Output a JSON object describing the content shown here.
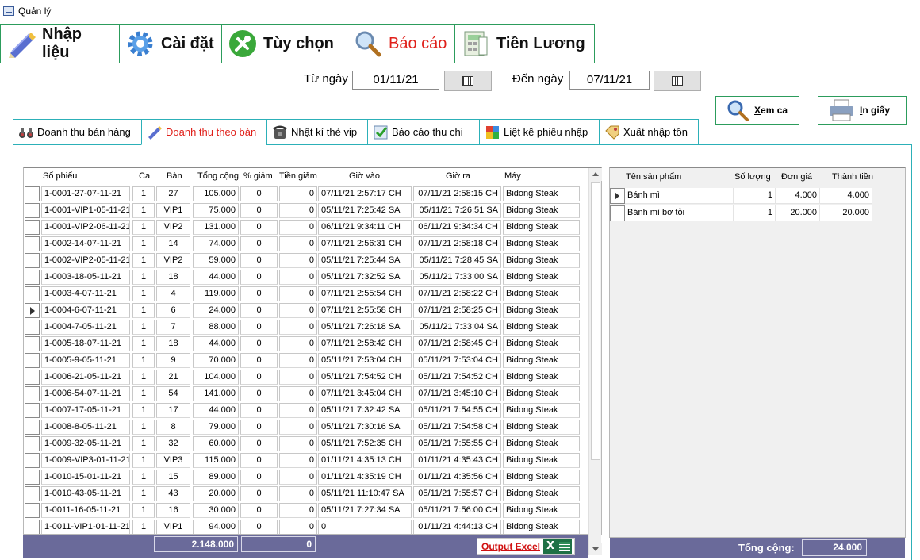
{
  "window": {
    "title": "Quản lý"
  },
  "main_tabs": [
    {
      "label": "Nhập liệu",
      "icon": "pencil-icon"
    },
    {
      "label": "Cài đặt",
      "icon": "gear-icon"
    },
    {
      "label": "Tùy chọn",
      "icon": "wrench-icon"
    },
    {
      "label": "Báo cáo",
      "icon": "magnifier-icon",
      "active": true
    },
    {
      "label": "Tiền Lương",
      "icon": "calculator-icon"
    }
  ],
  "filters": {
    "from_label": "Từ ngày",
    "from_value": "01/11/21",
    "to_label": "Đến ngày",
    "to_value": "07/11/21"
  },
  "actions": {
    "view_shift": "Xem ca",
    "view_shift_underline": "X",
    "view_shift_rest": "em ca",
    "print": "In giấy",
    "print_underline": "I",
    "print_rest": "n giấy"
  },
  "sub_tabs": [
    {
      "label": "Doanh thu bán hàng",
      "icon": "binoculars-icon"
    },
    {
      "label": "Doanh thu theo bàn",
      "icon": "pencil-icon",
      "active": true
    },
    {
      "label": "Nhật kí thẻ vip",
      "icon": "phone-icon"
    },
    {
      "label": "Báo cáo thu chi",
      "icon": "checklist-icon"
    },
    {
      "label": "Liệt kê phiếu nhập",
      "icon": "color-grid-icon"
    },
    {
      "label": "Xuất nhập tồn",
      "icon": "tag-icon"
    }
  ],
  "receipts": {
    "columns": [
      "Số phiếu",
      "Ca",
      "Bàn",
      "Tổng cộng",
      "% giảm",
      "Tiền giảm",
      "Giờ vào",
      "Giờ ra",
      "Máy"
    ],
    "rows": [
      [
        "1-0001-27-07-11-21",
        "1",
        "27",
        "105.000",
        "0",
        "0",
        "07/11/21 2:57:17 CH",
        "07/11/21 2:58:15 CH",
        "Bidong Steak"
      ],
      [
        "1-0001-VIP1-05-11-21",
        "1",
        "VIP1",
        "75.000",
        "0",
        "0",
        "05/11/21 7:25:42 SA",
        "05/11/21 7:26:51 SA",
        "Bidong Steak"
      ],
      [
        "1-0001-VIP2-06-11-21",
        "1",
        "VIP2",
        "131.000",
        "0",
        "0",
        "06/11/21 9:34:11 CH",
        "06/11/21 9:34:34 CH",
        "Bidong Steak"
      ],
      [
        "1-0002-14-07-11-21",
        "1",
        "14",
        "74.000",
        "0",
        "0",
        "07/11/21 2:56:31 CH",
        "07/11/21 2:58:18 CH",
        "Bidong Steak"
      ],
      [
        "1-0002-VIP2-05-11-21",
        "1",
        "VIP2",
        "59.000",
        "0",
        "0",
        "05/11/21 7:25:44 SA",
        "05/11/21 7:28:45 SA",
        "Bidong Steak"
      ],
      [
        "1-0003-18-05-11-21",
        "1",
        "18",
        "44.000",
        "0",
        "0",
        "05/11/21 7:32:52 SA",
        "05/11/21 7:33:00 SA",
        "Bidong Steak"
      ],
      [
        "1-0003-4-07-11-21",
        "1",
        "4",
        "119.000",
        "0",
        "0",
        "07/11/21 2:55:54 CH",
        "07/11/21 2:58:22 CH",
        "Bidong Steak"
      ],
      [
        "1-0004-6-07-11-21",
        "1",
        "6",
        "24.000",
        "0",
        "0",
        "07/11/21 2:55:58 CH",
        "07/11/21 2:58:25 CH",
        "Bidong Steak"
      ],
      [
        "1-0004-7-05-11-21",
        "1",
        "7",
        "88.000",
        "0",
        "0",
        "05/11/21 7:26:18 SA",
        "05/11/21 7:33:04 SA",
        "Bidong Steak"
      ],
      [
        "1-0005-18-07-11-21",
        "1",
        "18",
        "44.000",
        "0",
        "0",
        "07/11/21 2:58:42 CH",
        "07/11/21 2:58:45 CH",
        "Bidong Steak"
      ],
      [
        "1-0005-9-05-11-21",
        "1",
        "9",
        "70.000",
        "0",
        "0",
        "05/11/21 7:53:04 CH",
        "05/11/21 7:53:04 CH",
        "Bidong Steak"
      ],
      [
        "1-0006-21-05-11-21",
        "1",
        "21",
        "104.000",
        "0",
        "0",
        "05/11/21 7:54:52 CH",
        "05/11/21 7:54:52 CH",
        "Bidong Steak"
      ],
      [
        "1-0006-54-07-11-21",
        "1",
        "54",
        "141.000",
        "0",
        "0",
        "07/11/21 3:45:04 CH",
        "07/11/21 3:45:10 CH",
        "Bidong Steak"
      ],
      [
        "1-0007-17-05-11-21",
        "1",
        "17",
        "44.000",
        "0",
        "0",
        "05/11/21 7:32:42 SA",
        "05/11/21 7:54:55 CH",
        "Bidong Steak"
      ],
      [
        "1-0008-8-05-11-21",
        "1",
        "8",
        "79.000",
        "0",
        "0",
        "05/11/21 7:30:16 SA",
        "05/11/21 7:54:58 CH",
        "Bidong Steak"
      ],
      [
        "1-0009-32-05-11-21",
        "1",
        "32",
        "60.000",
        "0",
        "0",
        "05/11/21 7:52:35 CH",
        "05/11/21 7:55:55 CH",
        "Bidong Steak"
      ],
      [
        "1-0009-VIP3-01-11-21",
        "1",
        "VIP3",
        "115.000",
        "0",
        "0",
        "01/11/21 4:35:13 CH",
        "01/11/21 4:35:43 CH",
        "Bidong Steak"
      ],
      [
        "1-0010-15-01-11-21",
        "1",
        "15",
        "89.000",
        "0",
        "0",
        "01/11/21 4:35:19 CH",
        "01/11/21 4:35:56 CH",
        "Bidong Steak"
      ],
      [
        "1-0010-43-05-11-21",
        "1",
        "43",
        "20.000",
        "0",
        "0",
        "05/11/21 11:10:47 SA",
        "05/11/21 7:55:57 CH",
        "Bidong Steak"
      ],
      [
        "1-0011-16-05-11-21",
        "1",
        "16",
        "30.000",
        "0",
        "0",
        "05/11/21 7:27:34 SA",
        "05/11/21 7:56:00 CH",
        "Bidong Steak"
      ],
      [
        "1-0011-VIP1-01-11-21",
        "1",
        "VIP1",
        "94.000",
        "0",
        "0",
        "0",
        "01/11/21 4:44:13 CH",
        "Bidong Steak"
      ]
    ],
    "current_row": 7,
    "total_amount": "2.148.000",
    "total_discount": "0",
    "export_label": "Output Excel"
  },
  "details": {
    "columns": [
      "Tên sản phẩm",
      "Số lượng",
      "Đơn giá",
      "Thành tiền"
    ],
    "rows": [
      [
        "Bánh mì",
        "1",
        "4.000",
        "4.000"
      ],
      [
        "Bánh mì bơ tỏi",
        "1",
        "20.000",
        "20.000"
      ]
    ],
    "current_row": 0,
    "total_label": "Tổng cộng:",
    "total_value": "24.000"
  }
}
